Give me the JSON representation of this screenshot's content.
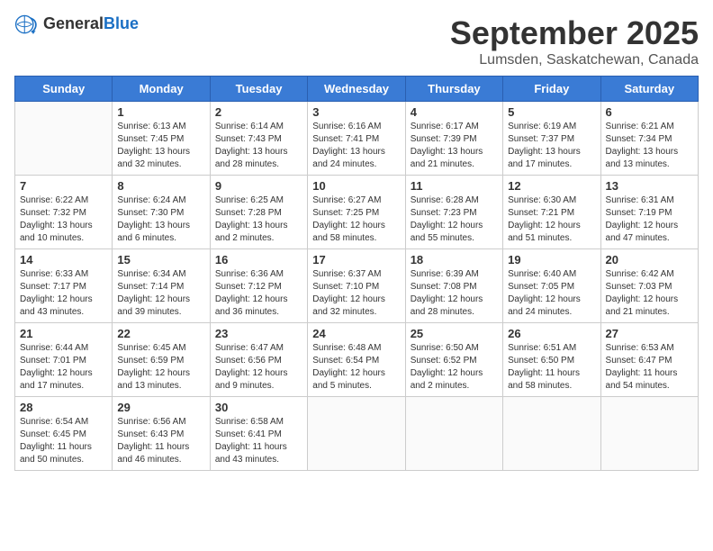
{
  "logo": {
    "general": "General",
    "blue": "Blue"
  },
  "header": {
    "month": "September 2025",
    "location": "Lumsden, Saskatchewan, Canada"
  },
  "weekdays": [
    "Sunday",
    "Monday",
    "Tuesday",
    "Wednesday",
    "Thursday",
    "Friday",
    "Saturday"
  ],
  "weeks": [
    [
      {
        "day": "",
        "info": ""
      },
      {
        "day": "1",
        "info": "Sunrise: 6:13 AM\nSunset: 7:45 PM\nDaylight: 13 hours and 32 minutes."
      },
      {
        "day": "2",
        "info": "Sunrise: 6:14 AM\nSunset: 7:43 PM\nDaylight: 13 hours and 28 minutes."
      },
      {
        "day": "3",
        "info": "Sunrise: 6:16 AM\nSunset: 7:41 PM\nDaylight: 13 hours and 24 minutes."
      },
      {
        "day": "4",
        "info": "Sunrise: 6:17 AM\nSunset: 7:39 PM\nDaylight: 13 hours and 21 minutes."
      },
      {
        "day": "5",
        "info": "Sunrise: 6:19 AM\nSunset: 7:37 PM\nDaylight: 13 hours and 17 minutes."
      },
      {
        "day": "6",
        "info": "Sunrise: 6:21 AM\nSunset: 7:34 PM\nDaylight: 13 hours and 13 minutes."
      }
    ],
    [
      {
        "day": "7",
        "info": "Sunrise: 6:22 AM\nSunset: 7:32 PM\nDaylight: 13 hours and 10 minutes."
      },
      {
        "day": "8",
        "info": "Sunrise: 6:24 AM\nSunset: 7:30 PM\nDaylight: 13 hours and 6 minutes."
      },
      {
        "day": "9",
        "info": "Sunrise: 6:25 AM\nSunset: 7:28 PM\nDaylight: 13 hours and 2 minutes."
      },
      {
        "day": "10",
        "info": "Sunrise: 6:27 AM\nSunset: 7:25 PM\nDaylight: 12 hours and 58 minutes."
      },
      {
        "day": "11",
        "info": "Sunrise: 6:28 AM\nSunset: 7:23 PM\nDaylight: 12 hours and 55 minutes."
      },
      {
        "day": "12",
        "info": "Sunrise: 6:30 AM\nSunset: 7:21 PM\nDaylight: 12 hours and 51 minutes."
      },
      {
        "day": "13",
        "info": "Sunrise: 6:31 AM\nSunset: 7:19 PM\nDaylight: 12 hours and 47 minutes."
      }
    ],
    [
      {
        "day": "14",
        "info": "Sunrise: 6:33 AM\nSunset: 7:17 PM\nDaylight: 12 hours and 43 minutes."
      },
      {
        "day": "15",
        "info": "Sunrise: 6:34 AM\nSunset: 7:14 PM\nDaylight: 12 hours and 39 minutes."
      },
      {
        "day": "16",
        "info": "Sunrise: 6:36 AM\nSunset: 7:12 PM\nDaylight: 12 hours and 36 minutes."
      },
      {
        "day": "17",
        "info": "Sunrise: 6:37 AM\nSunset: 7:10 PM\nDaylight: 12 hours and 32 minutes."
      },
      {
        "day": "18",
        "info": "Sunrise: 6:39 AM\nSunset: 7:08 PM\nDaylight: 12 hours and 28 minutes."
      },
      {
        "day": "19",
        "info": "Sunrise: 6:40 AM\nSunset: 7:05 PM\nDaylight: 12 hours and 24 minutes."
      },
      {
        "day": "20",
        "info": "Sunrise: 6:42 AM\nSunset: 7:03 PM\nDaylight: 12 hours and 21 minutes."
      }
    ],
    [
      {
        "day": "21",
        "info": "Sunrise: 6:44 AM\nSunset: 7:01 PM\nDaylight: 12 hours and 17 minutes."
      },
      {
        "day": "22",
        "info": "Sunrise: 6:45 AM\nSunset: 6:59 PM\nDaylight: 12 hours and 13 minutes."
      },
      {
        "day": "23",
        "info": "Sunrise: 6:47 AM\nSunset: 6:56 PM\nDaylight: 12 hours and 9 minutes."
      },
      {
        "day": "24",
        "info": "Sunrise: 6:48 AM\nSunset: 6:54 PM\nDaylight: 12 hours and 5 minutes."
      },
      {
        "day": "25",
        "info": "Sunrise: 6:50 AM\nSunset: 6:52 PM\nDaylight: 12 hours and 2 minutes."
      },
      {
        "day": "26",
        "info": "Sunrise: 6:51 AM\nSunset: 6:50 PM\nDaylight: 11 hours and 58 minutes."
      },
      {
        "day": "27",
        "info": "Sunrise: 6:53 AM\nSunset: 6:47 PM\nDaylight: 11 hours and 54 minutes."
      }
    ],
    [
      {
        "day": "28",
        "info": "Sunrise: 6:54 AM\nSunset: 6:45 PM\nDaylight: 11 hours and 50 minutes."
      },
      {
        "day": "29",
        "info": "Sunrise: 6:56 AM\nSunset: 6:43 PM\nDaylight: 11 hours and 46 minutes."
      },
      {
        "day": "30",
        "info": "Sunrise: 6:58 AM\nSunset: 6:41 PM\nDaylight: 11 hours and 43 minutes."
      },
      {
        "day": "",
        "info": ""
      },
      {
        "day": "",
        "info": ""
      },
      {
        "day": "",
        "info": ""
      },
      {
        "day": "",
        "info": ""
      }
    ]
  ]
}
